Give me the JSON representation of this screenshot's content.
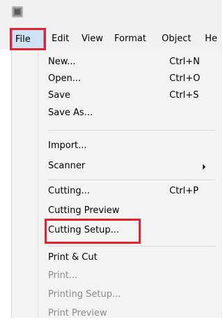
{
  "menubar": {
    "items": [
      "File",
      "Edit",
      "View",
      "Format",
      "Object",
      "He"
    ]
  },
  "file_menu": {
    "items": [
      {
        "label": "New...",
        "shortcut": "Ctrl+N"
      },
      {
        "label": "Open...",
        "shortcut": "Ctrl+O"
      },
      {
        "label": "Save",
        "shortcut": "Ctrl+S"
      },
      {
        "label": "Save As...",
        "shortcut": ""
      },
      {
        "label": "Import...",
        "shortcut": ""
      },
      {
        "label": "Scanner",
        "shortcut": ""
      },
      {
        "label": "Cutting...",
        "shortcut": "Ctrl+P"
      },
      {
        "label": "Cutting Preview",
        "shortcut": ""
      },
      {
        "label": "Cutting Setup...",
        "shortcut": ""
      },
      {
        "label": "Print & Cut",
        "shortcut": ""
      },
      {
        "label": "Print...",
        "shortcut": ""
      },
      {
        "label": "Printing Setup...",
        "shortcut": ""
      },
      {
        "label": "Print Preview",
        "shortcut": ""
      }
    ]
  },
  "colors": {
    "highlight_box": "#e0252f",
    "menu_selected": "#cfe3f6",
    "disabled_text": "#8a8a8a"
  }
}
